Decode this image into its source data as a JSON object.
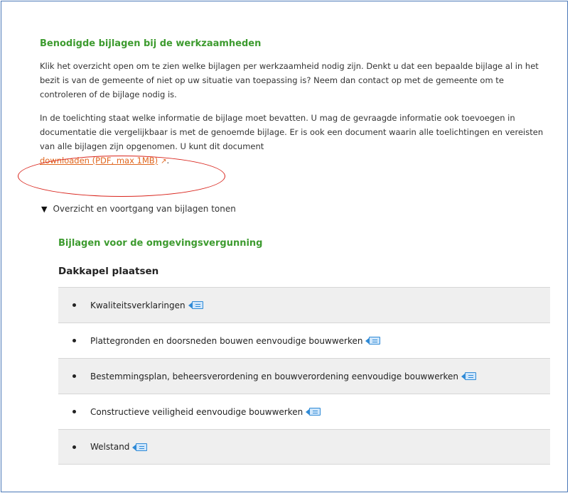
{
  "section": {
    "heading": "Benodigde bijlagen bij de werkzaamheden",
    "paragraph1": "Klik het overzicht open om te zien welke bijlagen per werkzaamheid nodig zijn. Denkt u dat een bepaalde bijlage al in het bezit is van de gemeente of niet op uw situatie van toepassing is? Neem dan contact op met de gemeente om te controleren of de bijlage nodig is.",
    "paragraph2": "In de toelichting staat welke informatie de bijlage moet bevatten. U mag de gevraagde informatie ook toevoegen in documentatie die vergelijkbaar is met de genoemde bijlage. Er is ook een document waarin alle toelichtingen en vereisten van alle bijlagen zijn opgenomen. U kunt dit document",
    "download_link": "downloaden (PDF, max 1MB)",
    "period": "."
  },
  "toggle": {
    "label": "Overzicht en voortgang van bijlagen tonen"
  },
  "vergunning": {
    "heading": "Bijlagen voor de omgevingsvergunning",
    "group": "Dakkapel plaatsen",
    "items": [
      {
        "label": "Kwaliteitsverklaringen"
      },
      {
        "label": "Plattegronden en doorsneden bouwen eenvoudige bouwwerken"
      },
      {
        "label": "Bestemmingsplan, beheersverordening en bouwverordening eenvoudige bouwwerken"
      },
      {
        "label": "Constructieve veiligheid eenvoudige bouwwerken"
      },
      {
        "label": "Welstand"
      }
    ]
  },
  "colors": {
    "heading_green": "#3d9b2f",
    "link_orange": "#e0661e",
    "annotation_red": "#d9241c",
    "frame_blue": "#4a78b8",
    "icon_blue": "#2f8ad6"
  },
  "icons": {
    "external_link": "external-link-icon",
    "toelichting": "document-info-icon",
    "toggle": "triangle-down-icon"
  }
}
